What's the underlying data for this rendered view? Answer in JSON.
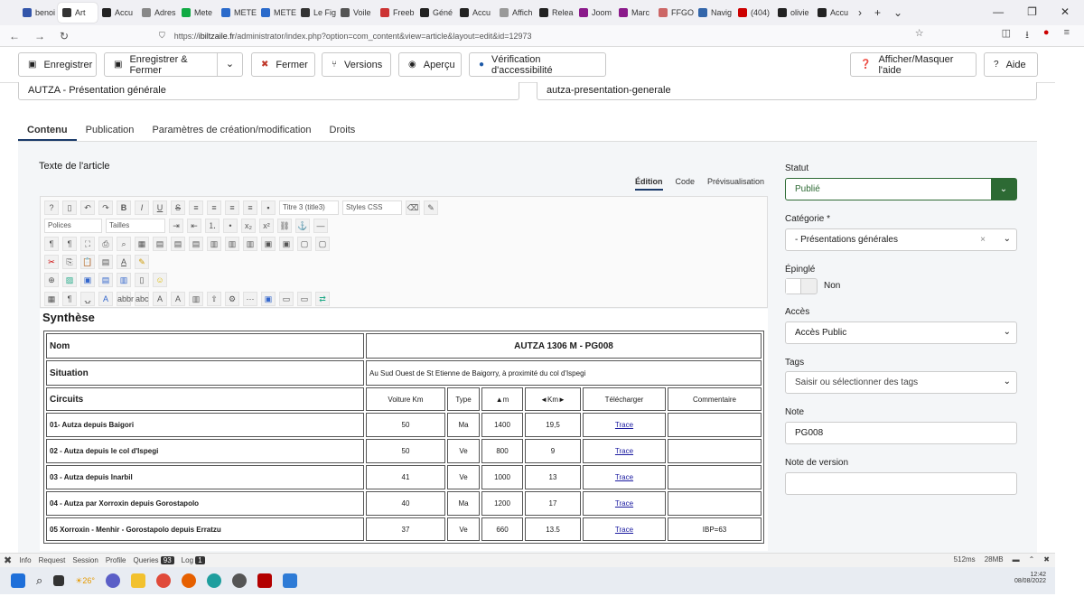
{
  "browser": {
    "tabs": [
      "benoi",
      "Art",
      "Accu",
      "Adres",
      "Mete",
      "METE",
      "METE",
      "Le Fig",
      "Voile",
      "Freeb",
      "Géné",
      "Accu",
      "Affich",
      "Relea",
      "Joom",
      "Marc",
      "FFGO",
      "Navig",
      "(404)",
      "olivie",
      "Accu"
    ],
    "url_prefix": "https://",
    "url_host": "ibiltzaile.fr",
    "url_path": "/administrator/index.php?option=com_content&view=article&layout=edit&id=12973"
  },
  "toolbar": {
    "save": "Enregistrer",
    "save_close": "Enregistrer & Fermer",
    "close": "Fermer",
    "versions": "Versions",
    "preview": "Aperçu",
    "accessibility": "Vérification d'accessibilité",
    "toggle_help": "Afficher/Masquer l'aide",
    "help": "Aide"
  },
  "fields": {
    "title": "AUTZA - Présentation générale",
    "alias": "autza-presentation-generale"
  },
  "tabs": [
    "Contenu",
    "Publication",
    "Paramètres de création/modification",
    "Droits"
  ],
  "editor": {
    "label": "Texte de l'article",
    "modes": [
      "Édition",
      "Code",
      "Prévisualisation"
    ],
    "format": "Titre 3 (title3)",
    "styles": "Styles CSS",
    "fonts": "Polices",
    "sizes": "Tailles"
  },
  "article": {
    "heading": "Synthèse",
    "name_label": "Nom",
    "name_value": "AUTZA 1306 M  -  PG008",
    "situation_label": "Situation",
    "situation_value": "Au Sud Ouest de St Etienne de Baigorry, à proximité du col d'Ispegi",
    "circuits_label": "Circuits",
    "columns": [
      "Voiture Km",
      "Type",
      "▲m",
      "◄Km►",
      "Télécharger",
      "Commentaire"
    ],
    "rows": [
      {
        "name": "01- Autza depuis Baigori",
        "km": "50",
        "type": "Ma",
        "dplus": "1400",
        "dist": "19,5",
        "dl": "Trace",
        "comment": ""
      },
      {
        "name": "02 - Autza depuis le col d'Ispegi",
        "km": "50",
        "type": "Ve",
        "dplus": "800",
        "dist": "9",
        "dl": "Trace",
        "comment": ""
      },
      {
        "name": "03 - Autza depuis Inarbil",
        "km": "41",
        "type": "Ve",
        "dplus": "1000",
        "dist": "13",
        "dl": "Trace",
        "comment": ""
      },
      {
        "name": "04 - Autza par Xorroxin depuis Gorostapolo",
        "km": "40",
        "type": "Ma",
        "dplus": "1200",
        "dist": "17",
        "dl": "Trace",
        "comment": ""
      },
      {
        "name": "05 Xorroxin - Menhir - Gorostapolo depuis Erratzu",
        "km": "37",
        "type": "Ve",
        "dplus": "660",
        "dist": "13.5",
        "dl": "Trace",
        "comment": "IBP=63"
      }
    ]
  },
  "sidebar": {
    "status_label": "Statut",
    "status": "Publié",
    "category_label": "Catégorie *",
    "category": "- Présentations générales",
    "featured_label": "Épinglé",
    "featured": "Non",
    "access_label": "Accès",
    "access": "Accès Public",
    "tags_label": "Tags",
    "tags_placeholder": "Saisir ou sélectionner des tags",
    "note_label": "Note",
    "note": "PG008",
    "version_note_label": "Note de version"
  },
  "debug": {
    "items": [
      "Info",
      "Request",
      "Session",
      "Profile",
      "Queries",
      "Log"
    ],
    "queries": "93",
    "log": "1",
    "time": "512ms",
    "mem": "28MB"
  },
  "taskbar": {
    "weather": "26°",
    "time": "12:42",
    "date": "08/08/2022"
  }
}
